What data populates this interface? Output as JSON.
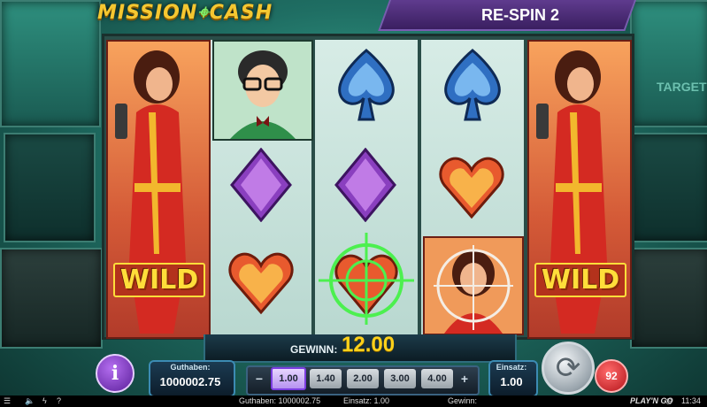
{
  "header": {
    "logo_part1": "MISSION",
    "logo_cross": "⌖",
    "logo_part2": "CASH",
    "respin_label": "RE-SPIN 2"
  },
  "background": {
    "target_text": "TARGET"
  },
  "reels": {
    "wild_label": "WILD",
    "symbols": {
      "reel2": [
        "agent-nerd",
        "purple-diamond",
        "heart"
      ],
      "reel3": [
        "blue-spade",
        "purple-diamond",
        "heart-crosshair"
      ],
      "reel4": [
        "blue-spade",
        "heart",
        "agent-woman-crosshair"
      ]
    },
    "colors": {
      "spade": "#2f6fc2",
      "diamond": "#8a3fbf",
      "heart": "#e85a2e",
      "crosshair": "#4cf04f"
    }
  },
  "win": {
    "label": "GEWINN:",
    "value": "12.00"
  },
  "controls": {
    "info_label": "i",
    "balance_label": "Guthaben:",
    "balance_value": "1000002.75",
    "bet_minus": "−",
    "bet_plus": "+",
    "bet_options": [
      "1.00",
      "1.40",
      "2.00",
      "3.00",
      "4.00"
    ],
    "selected_bet": "1.00",
    "stake_label": "Einsatz:",
    "stake_value": "1.00",
    "autoplay_count": "92"
  },
  "status_bar": {
    "balance_text": "Guthaben: 1000002.75",
    "stake_text": "Einsatz: 1.00",
    "win_text": "Gewinn:",
    "time": "11:34",
    "brand": "PLAY'N GO",
    "help": "?"
  }
}
